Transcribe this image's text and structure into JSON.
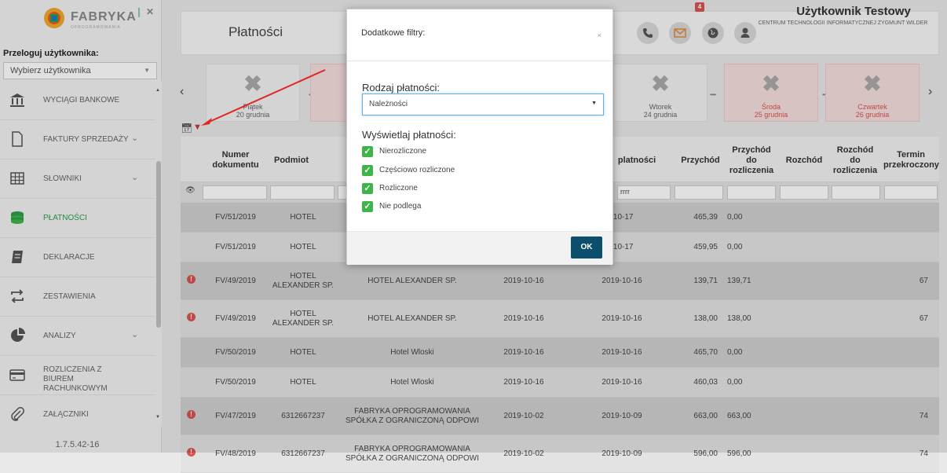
{
  "logo": {
    "name": "FABRYKA",
    "sub": "OPROGRAMOWANIA"
  },
  "sidebar": {
    "relogin_label": "Przeloguj użytkownika:",
    "user_select_placeholder": "Wybierz użytkownika",
    "items": [
      {
        "label": "WYCIĄGI BANKOWE",
        "icon": "bank-icon"
      },
      {
        "label": "FAKTURY SPRZEDAŻY",
        "icon": "document-icon",
        "expandable": true
      },
      {
        "label": "SŁOWNIKI",
        "icon": "table-icon",
        "expandable": true
      },
      {
        "label": "PŁATNOŚCI",
        "icon": "coins-icon",
        "active": true
      },
      {
        "label": "DEKLARACJE",
        "icon": "notebook-icon"
      },
      {
        "label": "ZESTAWIENIA",
        "icon": "transfer-icon"
      },
      {
        "label": "ANALIZY",
        "icon": "pie-chart-icon",
        "expandable": true
      },
      {
        "label": "ROZLICZENIA Z BIUREM RACHUNKOWYM",
        "icon": "card-icon"
      },
      {
        "label": "ZAŁĄCZNIKI",
        "icon": "paperclip-icon"
      }
    ],
    "version": "1.7.5.42-16"
  },
  "header": {
    "title": "Płatności",
    "mail_count": "4",
    "user_name": "Użytkownik Testowy",
    "user_org": "CENTRUM TECHNOLOGII INFORMATYCZNEJ ZYGMUNT WILDER"
  },
  "days": [
    {
      "day": "Piątek",
      "date": "20 grudnia",
      "status": "normal"
    },
    {
      "day": "Wtorek",
      "date": "24 grudnia",
      "status": "normal"
    },
    {
      "day": "Środa",
      "date": "25 grudnia",
      "status": "holiday"
    },
    {
      "day": "Czwartek",
      "date": "26 grudnia",
      "status": "holiday"
    }
  ],
  "table": {
    "headers": {
      "doc": "Numer dokumentu",
      "subject": "Podmiot",
      "payment_date": "platności",
      "income": "Przychód",
      "income_to_settle": "Przychód do rozliczenia",
      "expense": "Rozchód",
      "expense_to_settle": "Rozchód do rozliczenia",
      "overdue": "Termin przekroczony"
    },
    "filter_value_payment_date": "rrrr",
    "rows": [
      {
        "warn": false,
        "doc": "FV/51/2019",
        "subject": "HOTEL",
        "name": "",
        "date1": "",
        "date2": "-10-17",
        "income": "465,39",
        "to_settle": "0,00",
        "overdue": ""
      },
      {
        "warn": false,
        "doc": "FV/51/2019",
        "subject": "HOTEL",
        "name": "",
        "date1": "",
        "date2": "-10-17",
        "income": "459,95",
        "to_settle": "0,00",
        "overdue": ""
      },
      {
        "warn": true,
        "doc": "FV/49/2019",
        "subject": "HOTEL ALEXANDER SP.",
        "name": "HOTEL ALEXANDER SP.",
        "date1": "2019-10-16",
        "date2": "2019-10-16",
        "income": "139,71",
        "to_settle": "139,71",
        "overdue": "67"
      },
      {
        "warn": true,
        "doc": "FV/49/2019",
        "subject": "HOTEL ALEXANDER SP.",
        "name": "HOTEL ALEXANDER SP.",
        "date1": "2019-10-16",
        "date2": "2019-10-16",
        "income": "138,00",
        "to_settle": "138,00",
        "overdue": "67"
      },
      {
        "warn": false,
        "doc": "FV/50/2019",
        "subject": "HOTEL",
        "name": "Hotel Wloski",
        "date1": "2019-10-16",
        "date2": "2019-10-16",
        "income": "465,70",
        "to_settle": "0,00",
        "overdue": ""
      },
      {
        "warn": false,
        "doc": "FV/50/2019",
        "subject": "HOTEL",
        "name": "Hotel Wloski",
        "date1": "2019-10-16",
        "date2": "2019-10-16",
        "income": "460,03",
        "to_settle": "0,00",
        "overdue": ""
      },
      {
        "warn": true,
        "doc": "FV/47/2019",
        "subject": "6312667237",
        "name": "FABRYKA OPROGRAMOWANIA SPÓŁKA Z OGRANICZONĄ ODPOWI",
        "date1": "2019-10-02",
        "date2": "2019-10-09",
        "income": "663,00",
        "to_settle": "663,00",
        "overdue": "74"
      },
      {
        "warn": true,
        "doc": "FV/48/2019",
        "subject": "6312667237",
        "name": "FABRYKA OPROGRAMOWANIA SPÓŁKA Z OGRANICZONĄ ODPOWI",
        "date1": "2019-10-02",
        "date2": "2019-10-09",
        "income": "596,00",
        "to_settle": "596,00",
        "overdue": "74"
      }
    ]
  },
  "modal": {
    "title": "Dodatkowe filtry:",
    "close": "×",
    "payment_type_label": "Rodzaj płatności:",
    "payment_type_value": "Należności",
    "show_label": "Wyświetlaj płatności:",
    "options": [
      "Nierozliczone",
      "Częściowo rozliczone",
      "Rozliczone",
      "Nie podlega"
    ],
    "ok": "OK"
  },
  "colors": {
    "accent_green": "#2e9c4a",
    "checkbox_green": "#3fb449",
    "ok_button": "#0b4f6c",
    "warning_red": "#d9534f",
    "holiday_tile": "#f6dede"
  }
}
